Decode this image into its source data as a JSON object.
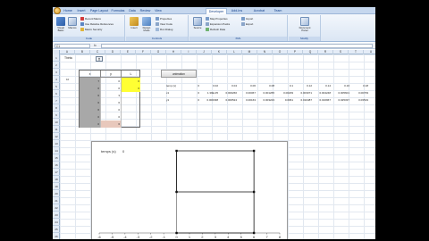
{
  "ribbon": {
    "tabs": [
      {
        "label": "Home",
        "active": false
      },
      {
        "label": "Insert",
        "active": false
      },
      {
        "label": "Page Layout",
        "active": false
      },
      {
        "label": "Formulas",
        "active": false
      },
      {
        "label": "Data",
        "active": false
      },
      {
        "label": "Review",
        "active": false
      },
      {
        "label": "View",
        "active": false
      },
      {
        "label": "Developer",
        "active": true
      },
      {
        "label": "Add-Ins",
        "active": false
      },
      {
        "label": "Acrobat",
        "active": false
      },
      {
        "label": "Team",
        "active": false
      }
    ],
    "groups": {
      "code": {
        "label": "Code",
        "visual_basic": "Visual Basic",
        "macros": "Macros",
        "record_macro": "Record Macro",
        "relative_refs": "Use Relative References",
        "macro_security": "Macro Security"
      },
      "controls": {
        "label": "Controls",
        "insert": "Insert",
        "design_mode": "Design Mode",
        "properties": "Properties",
        "view_code": "View Code",
        "run_dialog": "Run Dialog"
      },
      "xml": {
        "label": "XML",
        "source": "Source",
        "map_properties": "Map Properties",
        "expansion_packs": "Expansion Packs",
        "refresh_data": "Refresh Data",
        "import": "Import",
        "export": "Export"
      },
      "modify": {
        "label": "Modify",
        "document_panel": "Document Panel"
      }
    }
  },
  "formula_bar": {
    "name_box": "C1",
    "fx": "fx",
    "value": ""
  },
  "grid": {
    "columns": [
      "A",
      "B",
      "C",
      "D",
      "E",
      "F",
      "G",
      "H",
      "I",
      "J",
      "K",
      "L",
      "M",
      "N",
      "O",
      "P",
      "Q",
      "R",
      "S",
      "T",
      "U"
    ],
    "rows": [
      "1",
      "2",
      "3",
      "4",
      "5",
      "6",
      "7",
      "8",
      "9",
      "10",
      "11",
      "12",
      "13",
      "14",
      "15",
      "16",
      "17",
      "18",
      "19",
      "20",
      "21",
      "22",
      "23",
      "24",
      "25",
      "26"
    ],
    "spinner_label": "Thèta",
    "spinner_value": "0",
    "b_col_label": "10",
    "table": {
      "headers": [
        "x",
        "y",
        "L"
      ],
      "rows": [
        {
          "x": "7",
          "y": "0",
          "L": "6"
        },
        {
          "x": "6",
          "y": "0",
          "L": "6"
        },
        {
          "x": "6",
          "y": "3",
          "L": ""
        },
        {
          "x": "6",
          "y": "6",
          "L": ""
        },
        {
          "x": "6",
          "y": "0",
          "L": ""
        },
        {
          "x": "0",
          "y": "0",
          "L": ""
        },
        {
          "x": "0",
          "y": "6",
          "L": ""
        }
      ]
    },
    "animation_button": "animation",
    "right_table": {
      "row1": {
        "label": "temp (s)",
        "values": [
          "0",
          "0.02",
          "0.04",
          "0.06",
          "0.08",
          "0.1",
          "0.12",
          "0.14",
          "0.16",
          "0.18"
        ]
      },
      "row2": {
        "label": "x1",
        "values": [
          "0",
          "1.39E-05",
          "0.000266",
          "0.00067",
          "0.001265",
          "0.00209",
          "0.003071",
          "0.004248",
          "0.005601",
          "0.00709"
        ]
      },
      "row3": {
        "label": "y1",
        "values": [
          "0",
          "0.000338",
          "0.000524",
          "0.00163",
          "0.003223",
          "0.0061",
          "0.010487",
          "0.016967",
          "0.025337",
          "0.03519"
        ]
      }
    }
  },
  "chart_data": {
    "type": "scatter",
    "annotation_label": "temps (s)",
    "annotation_value": "0",
    "xlim": [
      -6,
      8
    ],
    "ylim": [
      0,
      6
    ],
    "x_ticks": [
      "-6",
      "-5",
      "-4",
      "-3",
      "-2",
      "-1",
      "0",
      "1",
      "2",
      "3",
      "4",
      "5",
      "6",
      "7",
      "8"
    ],
    "y_ticks": [
      "0",
      "3",
      "6"
    ],
    "series": [
      {
        "x": [
          0,
          6,
          6,
          0,
          0,
          6
        ],
        "y": [
          0,
          0,
          6,
          6,
          3,
          3
        ],
        "line": true,
        "marker": "square"
      }
    ],
    "grid": false,
    "color": "#111111"
  }
}
